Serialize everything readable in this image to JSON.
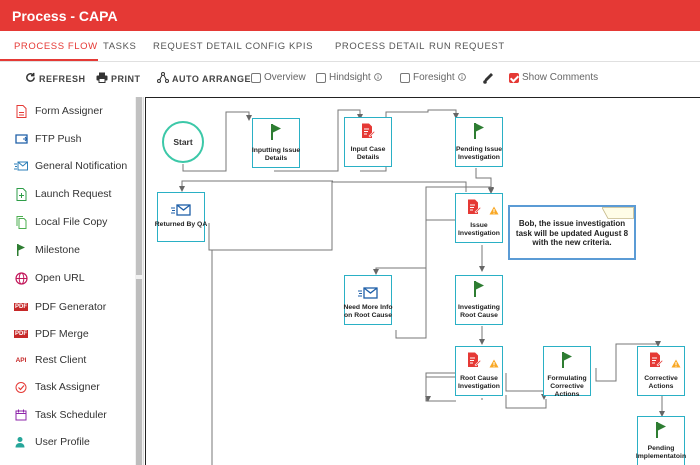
{
  "header": {
    "title": "Process - CAPA",
    "color": "#e53935"
  },
  "tabs": [
    {
      "label": "PROCESS FLOW",
      "active": true
    },
    {
      "label": "TASKS"
    },
    {
      "label": "REQUEST DETAIL CONFIG"
    },
    {
      "label": "KPIS"
    },
    {
      "label": "PROCESS DETAIL"
    },
    {
      "label": "RUN REQUEST"
    }
  ],
  "toolbar": {
    "refresh": "REFRESH",
    "print": "PRINT",
    "auto_arrange": "AUTO ARRANGE",
    "overview": {
      "label": "Overview",
      "checked": false
    },
    "hindsight": {
      "label": "Hindsight",
      "checked": false
    },
    "foresight": {
      "label": "Foresight",
      "checked": false
    },
    "show_comments": {
      "label": "Show Comments",
      "checked": true
    }
  },
  "sidebar": {
    "items": [
      {
        "label": "Form Assigner",
        "icon": "form-icon"
      },
      {
        "label": "FTP Push",
        "icon": "ftp-icon"
      },
      {
        "label": "General Notification",
        "icon": "notification-icon"
      },
      {
        "label": "Launch Request",
        "icon": "launch-icon"
      },
      {
        "label": "Local File Copy",
        "icon": "file-copy-icon"
      },
      {
        "label": "Milestone",
        "icon": "flag-icon"
      },
      {
        "label": "Open URL",
        "icon": "globe-icon"
      },
      {
        "label": "PDF Generator",
        "icon": "pdf-icon"
      },
      {
        "label": "PDF Merge",
        "icon": "pdf-icon"
      },
      {
        "label": "Rest Client",
        "icon": "api-icon"
      },
      {
        "label": "Task Assigner",
        "icon": "task-assigner-icon"
      },
      {
        "label": "Task Scheduler",
        "icon": "calendar-icon"
      },
      {
        "label": "User Profile",
        "icon": "user-icon"
      }
    ],
    "badges": {
      "pdf": "PDF",
      "api": "API"
    }
  },
  "flow": {
    "start": "Start",
    "nodes": {
      "inputting_issue_details": "Inputting Issue Details",
      "input_case_details": "Input Case Details",
      "pending_issue_investigation": "Pending Issue Investigation",
      "returned_by_qa": "Returned By QA",
      "issue_investigation": "Issue Investigation",
      "need_more_info": "Need More Info on Root Cause",
      "investigating_root_cause": "Investigating Root Cause",
      "root_cause_investigation": "Root Cause Investigation",
      "formulating_corrective_actions": "Formulating Corrective Actions",
      "corrective_actions": "Corrective Actions",
      "pending_implementation": "Pending Implementatoin"
    },
    "comment": "Bob, the issue investigation task will be updated August 8 with the new criteria."
  }
}
